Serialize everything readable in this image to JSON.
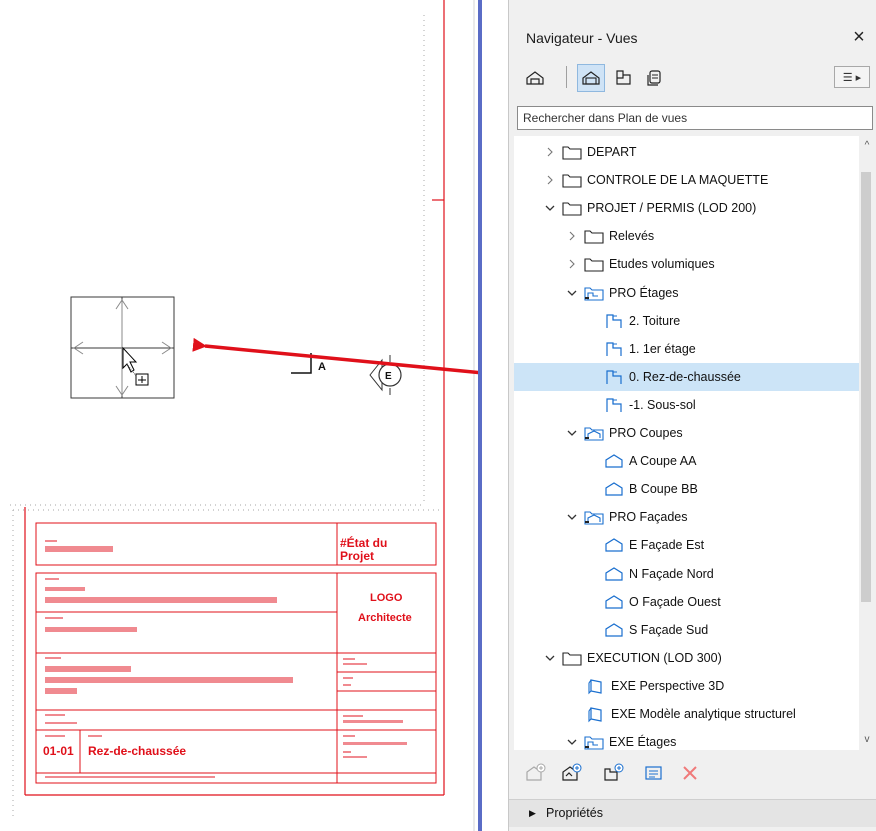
{
  "panel": {
    "title": "Navigateur - Vues",
    "close_label": "×",
    "search_placeholder": "Rechercher dans Plan de vues",
    "toolbar": [
      {
        "name": "project-map-icon"
      },
      {
        "name": "view-map-icon",
        "active": true
      },
      {
        "name": "layout-book-icon"
      },
      {
        "name": "publisher-sets-icon"
      }
    ],
    "menu_label": "☰ ▸",
    "tree": [
      {
        "level": 0,
        "expander": "collapsed",
        "icon": "folder",
        "label": "DEPART"
      },
      {
        "level": 0,
        "expander": "collapsed",
        "icon": "folder",
        "label": "CONTROLE DE LA MAQUETTE"
      },
      {
        "level": 0,
        "expander": "expanded",
        "icon": "folder",
        "label": "PROJET / PERMIS (LOD 200)"
      },
      {
        "level": 1,
        "expander": "collapsed",
        "icon": "folder",
        "label": "Relevés"
      },
      {
        "level": 1,
        "expander": "collapsed",
        "icon": "folder",
        "label": "Etudes volumiques"
      },
      {
        "level": 1,
        "expander": "expanded",
        "icon": "story-folder",
        "label": "PRO Étages"
      },
      {
        "level": 2,
        "expander": "none",
        "icon": "story",
        "label": "2. Toiture"
      },
      {
        "level": 2,
        "expander": "none",
        "icon": "story",
        "label": "1. 1er étage"
      },
      {
        "level": 2,
        "expander": "none",
        "icon": "story",
        "label": "0. Rez-de-chaussée",
        "selected": true
      },
      {
        "level": 2,
        "expander": "none",
        "icon": "story",
        "label": "-1. Sous-sol"
      },
      {
        "level": 1,
        "expander": "expanded",
        "icon": "section-folder",
        "label": "PRO Coupes"
      },
      {
        "level": 2,
        "expander": "none",
        "icon": "section",
        "label": "A Coupe AA"
      },
      {
        "level": 2,
        "expander": "none",
        "icon": "section",
        "label": "B Coupe BB"
      },
      {
        "level": 1,
        "expander": "expanded",
        "icon": "section-folder",
        "label": "PRO Façades"
      },
      {
        "level": 2,
        "expander": "none",
        "icon": "section",
        "label": "E Façade Est"
      },
      {
        "level": 2,
        "expander": "none",
        "icon": "section",
        "label": "N Façade Nord"
      },
      {
        "level": 2,
        "expander": "none",
        "icon": "section",
        "label": "O Façade Ouest"
      },
      {
        "level": 2,
        "expander": "none",
        "icon": "section",
        "label": "S Façade Sud"
      },
      {
        "level": 0,
        "expander": "expanded",
        "icon": "folder",
        "label": "EXECUTION (LOD 300)"
      },
      {
        "level": 1,
        "expander": "none",
        "icon": "3d",
        "label": "EXE Perspective 3D"
      },
      {
        "level": 1,
        "expander": "none",
        "icon": "3d",
        "label": "EXE Modèle analytique structurel"
      },
      {
        "level": 1,
        "expander": "expanded",
        "icon": "story-folder",
        "label": "EXE Étages"
      }
    ],
    "bottom_tools": [
      {
        "name": "new-view-icon",
        "disabled": true
      },
      {
        "name": "clone-folder-icon"
      },
      {
        "name": "new-folder-icon"
      },
      {
        "name": "view-settings-icon"
      },
      {
        "name": "delete-icon"
      }
    ],
    "properties_label": "Propriétés",
    "scroll_up": "^",
    "scroll_down": "v"
  },
  "drawing": {
    "section_marker_label": "A",
    "elevation_marker_label": "E",
    "title_block": {
      "state_label": "#État du Projet",
      "logo_label": "LOGO",
      "architect_label": "Architecte",
      "sheet_number": "01-01",
      "sheet_name": "Rez-de-chaussée"
    }
  },
  "colors": {
    "accent_red": "#e0101a",
    "selection": "#cce4f7",
    "divider_blue": "#5a6cc6"
  }
}
